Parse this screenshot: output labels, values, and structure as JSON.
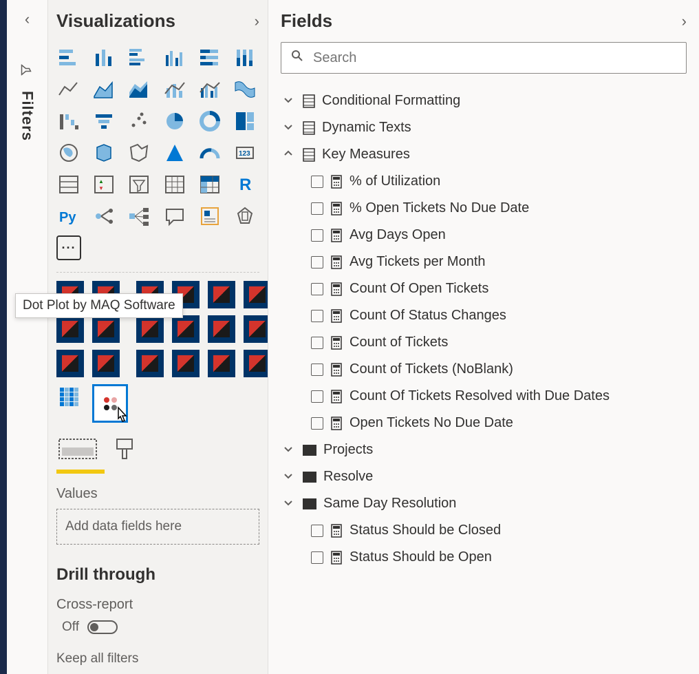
{
  "filters": {
    "label": "Filters"
  },
  "visualizations": {
    "title": "Visualizations",
    "tooltip": "Dot Plot by MAQ Software",
    "values_label": "Values",
    "drop_hint": "Add data fields here",
    "drill_title": "Drill through",
    "cross_report_label": "Cross-report",
    "toggle_state": "Off",
    "keep_filters_label": "Keep all filters"
  },
  "fields": {
    "title": "Fields",
    "search_placeholder": "Search",
    "tables": [
      {
        "name": "Conditional Formatting",
        "expanded": false,
        "type": "table"
      },
      {
        "name": "Dynamic Texts",
        "expanded": false,
        "type": "table"
      },
      {
        "name": "Key Measures",
        "expanded": true,
        "type": "table",
        "measures": [
          "% of Utilization",
          "% Open Tickets No Due Date",
          "Avg Days Open",
          "Avg Tickets per Month",
          "Count Of Open Tickets",
          "Count Of Status Changes",
          "Count of Tickets",
          "Count of Tickets (NoBlank)",
          "Count Of Tickets Resolved with Due Dates",
          "Open Tickets No Due Date"
        ]
      },
      {
        "name": "Projects",
        "expanded": false,
        "type": "folder"
      },
      {
        "name": "Resolve",
        "expanded": false,
        "type": "folder"
      },
      {
        "name": "Same Day Resolution",
        "expanded": false,
        "type": "folder",
        "measures": [
          "Status Should be Closed",
          "Status Should be Open"
        ]
      }
    ]
  }
}
